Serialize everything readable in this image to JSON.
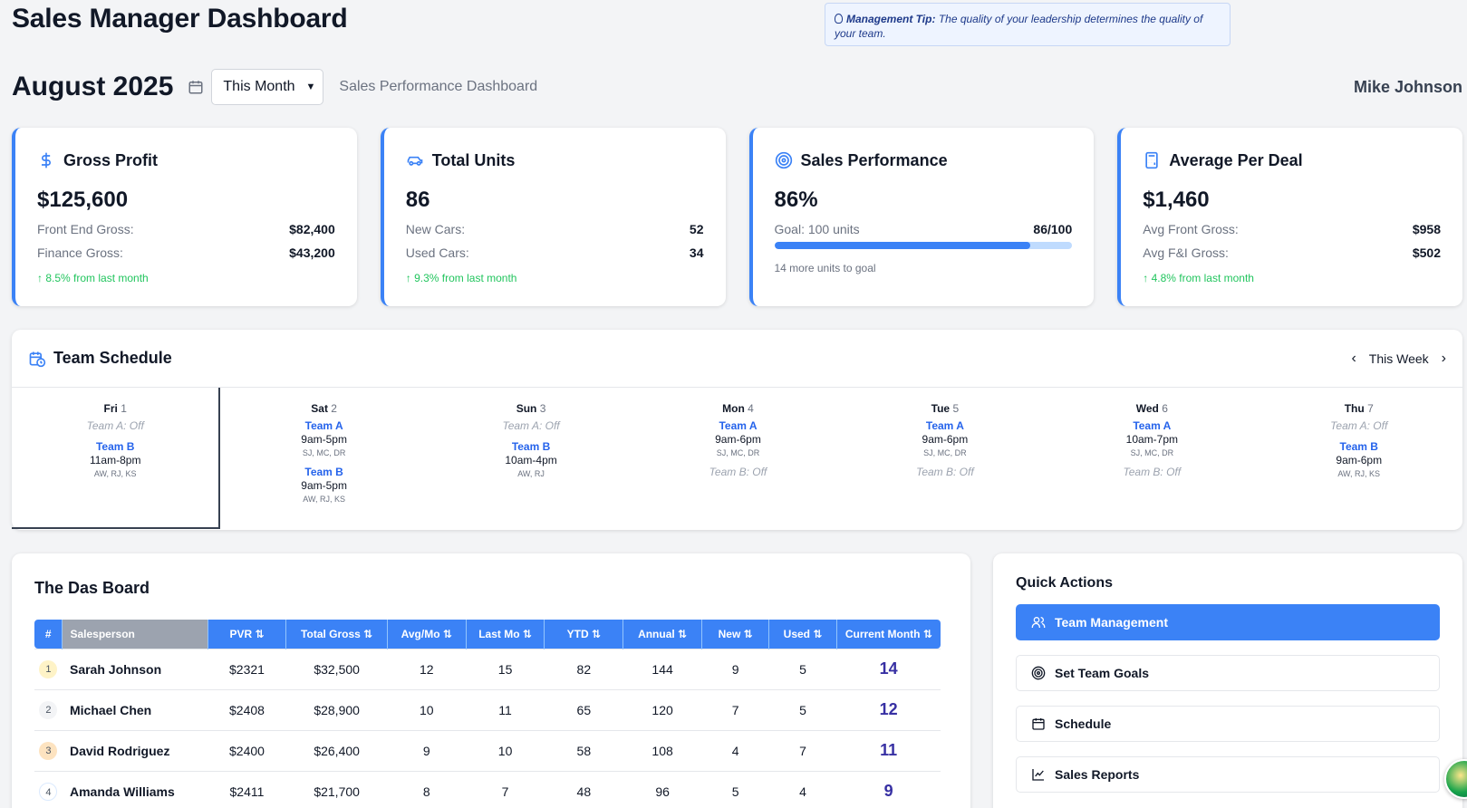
{
  "page_title": "Sales Manager Dashboard",
  "tip": {
    "label": "Management Tip:",
    "text": "The quality of your leadership determines the quality of your team."
  },
  "header": {
    "month": "August 2025",
    "period_select": "This Month",
    "subtitle": "Sales Performance Dashboard",
    "user": "Mike Johnson"
  },
  "cards": {
    "gross": {
      "title": "Gross Profit",
      "value": "$125,600",
      "r1_label": "Front End Gross:",
      "r1_value": "$82,400",
      "r2_label": "Finance Gross:",
      "r2_value": "$43,200",
      "trend": "8.5% from last month"
    },
    "units": {
      "title": "Total Units",
      "value": "86",
      "r1_label": "New Cars:",
      "r1_value": "52",
      "r2_label": "Used Cars:",
      "r2_value": "34",
      "trend": "9.3% from last month"
    },
    "performance": {
      "title": "Sales Performance",
      "value": "86%",
      "goal_label": "Goal: 100 units",
      "goal_value": "86/100",
      "progress": 0.86,
      "note": "14 more units to goal"
    },
    "average": {
      "title": "Average Per Deal",
      "value": "$1,460",
      "r1_label": "Avg Front Gross:",
      "r1_value": "$958",
      "r2_label": "Avg F&I Gross:",
      "r2_value": "$502",
      "trend": "4.8% from last month"
    }
  },
  "schedule": {
    "title": "Team Schedule",
    "range": "This Week",
    "days": [
      {
        "day": "Fri",
        "date": "1",
        "a_off": "Team A: Off",
        "b_team": "Team B",
        "b_hours": "11am-8pm",
        "b_members": "AW, RJ, KS"
      },
      {
        "day": "Sat",
        "date": "2",
        "a_team": "Team A",
        "a_hours": "9am-5pm",
        "a_members": "SJ, MC, DR",
        "b_team": "Team B",
        "b_hours": "9am-5pm",
        "b_members": "AW, RJ, KS"
      },
      {
        "day": "Sun",
        "date": "3",
        "a_off": "Team A: Off",
        "b_team": "Team B",
        "b_hours": "10am-4pm",
        "b_members": "AW, RJ"
      },
      {
        "day": "Mon",
        "date": "4",
        "a_team": "Team A",
        "a_hours": "9am-6pm",
        "a_members": "SJ, MC, DR",
        "b_off": "Team B: Off"
      },
      {
        "day": "Tue",
        "date": "5",
        "a_team": "Team A",
        "a_hours": "9am-6pm",
        "a_members": "SJ, MC, DR",
        "b_off": "Team B: Off"
      },
      {
        "day": "Wed",
        "date": "6",
        "a_team": "Team A",
        "a_hours": "10am-7pm",
        "a_members": "SJ, MC, DR",
        "b_off": "Team B: Off"
      },
      {
        "day": "Thu",
        "date": "7",
        "a_off": "Team A: Off",
        "b_team": "Team B",
        "b_hours": "9am-6pm",
        "b_members": "AW, RJ, KS"
      }
    ]
  },
  "das_board": {
    "title": "The Das Board",
    "columns": [
      "#",
      "Salesperson",
      "PVR ⇅",
      "Total Gross ⇅",
      "Avg/Mo ⇅",
      "Last Mo ⇅",
      "YTD ⇅",
      "Annual ⇅",
      "New ⇅",
      "Used ⇅",
      "Current Month ⇅"
    ],
    "rows": [
      [
        "1",
        "Sarah Johnson",
        "$2321",
        "$32,500",
        "12",
        "15",
        "82",
        "144",
        "9",
        "5",
        "14"
      ],
      [
        "2",
        "Michael Chen",
        "$2408",
        "$28,900",
        "10",
        "11",
        "65",
        "120",
        "7",
        "5",
        "12"
      ],
      [
        "3",
        "David Rodriguez",
        "$2400",
        "$26,400",
        "9",
        "10",
        "58",
        "108",
        "4",
        "7",
        "11"
      ],
      [
        "4",
        "Amanda Williams",
        "$2411",
        "$21,700",
        "8",
        "7",
        "48",
        "96",
        "5",
        "4",
        "9"
      ]
    ]
  },
  "quick_actions": {
    "title": "Quick Actions",
    "items": [
      "Team Management",
      "Set Team Goals",
      "Schedule",
      "Sales Reports"
    ]
  },
  "colors": {
    "accent": "#3b82f6",
    "positive": "#22c55e",
    "current_month": "#3730a3"
  }
}
